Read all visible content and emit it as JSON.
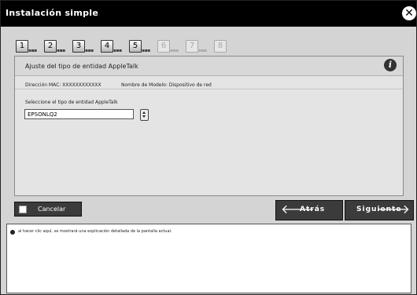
{
  "window": {
    "title": "Instalación simple",
    "close_icon": "close-icon"
  },
  "steps": [
    {
      "label": "1",
      "state": "active"
    },
    {
      "label": "2",
      "state": "active"
    },
    {
      "label": "3",
      "state": "active"
    },
    {
      "label": "4",
      "state": "active"
    },
    {
      "label": "5",
      "state": "active"
    },
    {
      "label": "6",
      "state": "inactive"
    },
    {
      "label": "7",
      "state": "inactive"
    },
    {
      "label": "8",
      "state": "inactive"
    }
  ],
  "panel": {
    "title": "Ajuste del tipo de entidad AppleTalk",
    "mac_label": "Dirección MAC: XXXXXXXXXXXX",
    "model_label": "Nombre de Modelo: Dispositivo de red",
    "select_label": "Seleccione el tipo de entidad AppleTalk",
    "entity_value": "EPSONLQ2"
  },
  "buttons": {
    "cancel": "Cancelar",
    "back": "Atrás",
    "next": "Siguiente"
  },
  "help": {
    "text": "al hacer clic aquí, se mostrará una explicación detallada de la pantalla actual."
  }
}
